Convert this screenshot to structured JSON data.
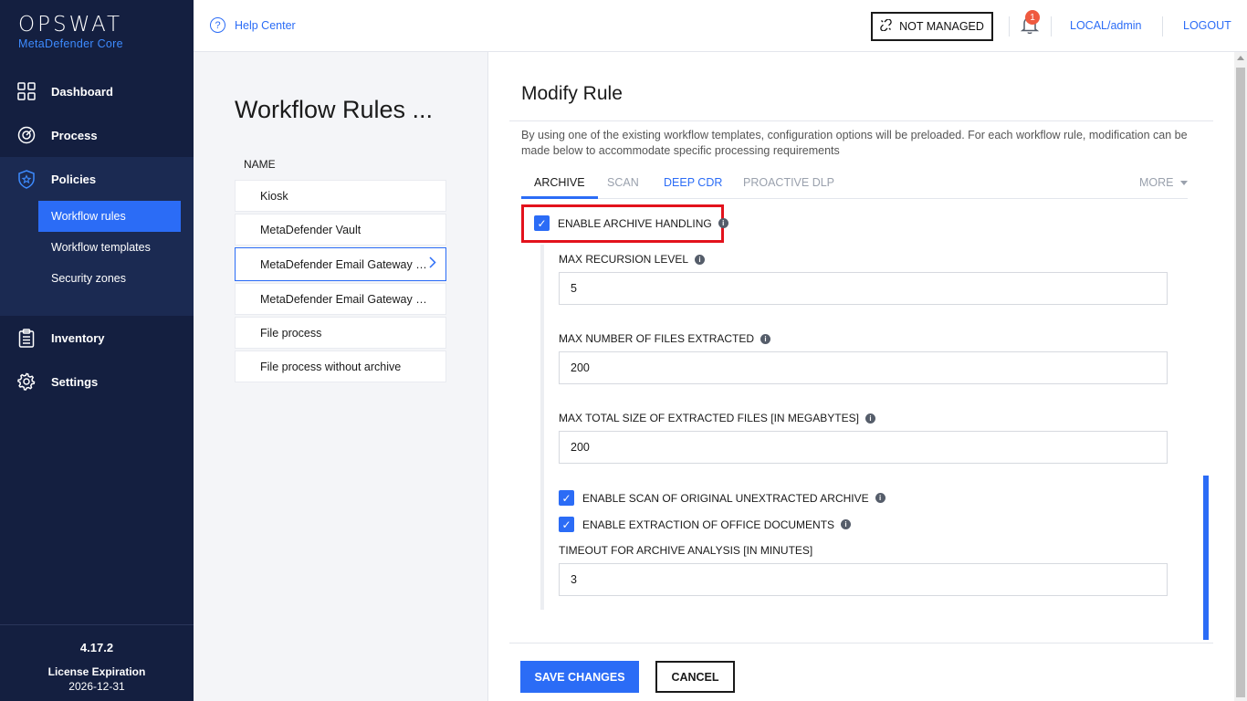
{
  "sidebar": {
    "logo": "OPSWAT",
    "product": "MetaDefender Core",
    "nav": {
      "dashboard": "Dashboard",
      "process": "Process",
      "policies": "Policies",
      "inventory": "Inventory",
      "settings": "Settings"
    },
    "policies_sub": [
      "Workflow rules",
      "Workflow templates",
      "Security zones"
    ],
    "version": "4.17.2",
    "license_label": "License Expiration",
    "license_date": "2026-12-31"
  },
  "topbar": {
    "help": "Help Center",
    "managed_status": "NOT MANAGED",
    "notification_count": "1",
    "user": "LOCAL/admin",
    "logout": "LOGOUT"
  },
  "list": {
    "title": "Workflow Rules ...",
    "column": "NAME",
    "rules": [
      "Kiosk",
      "MetaDefender Vault",
      "MetaDefender Email Gateway Se...",
      "MetaDefender Email Gateway Se...",
      "File process",
      "File process without archive"
    ],
    "selected_index": 2
  },
  "main": {
    "title": "Modify Rule",
    "description": "By using one of the existing workflow templates, configuration options will be preloaded. For each workflow rule, modification can be made below to accommodate specific processing requirements",
    "tabs": [
      "ARCHIVE",
      "SCAN",
      "DEEP CDR",
      "PROACTIVE DLP"
    ],
    "more": "MORE",
    "enable_archive": "ENABLE ARCHIVE HANDLING",
    "fields": {
      "max_recursion_label": "MAX RECURSION LEVEL",
      "max_recursion_value": "5",
      "max_files_label": "MAX NUMBER OF FILES EXTRACTED",
      "max_files_value": "200",
      "max_size_label": "MAX TOTAL SIZE OF EXTRACTED FILES [IN MEGABYTES]",
      "max_size_value": "200",
      "scan_original": "ENABLE SCAN OF ORIGINAL UNEXTRACTED ARCHIVE",
      "extract_office": "ENABLE EXTRACTION OF OFFICE DOCUMENTS",
      "timeout_label": "TIMEOUT FOR ARCHIVE ANALYSIS [IN MINUTES]",
      "timeout_value": "3"
    },
    "save": "SAVE CHANGES",
    "cancel": "CANCEL"
  },
  "colors": {
    "sidebar_bg": "#141f40",
    "accent": "#2b6cf6",
    "highlight": "#e3121c",
    "badge": "#ef5a40"
  }
}
